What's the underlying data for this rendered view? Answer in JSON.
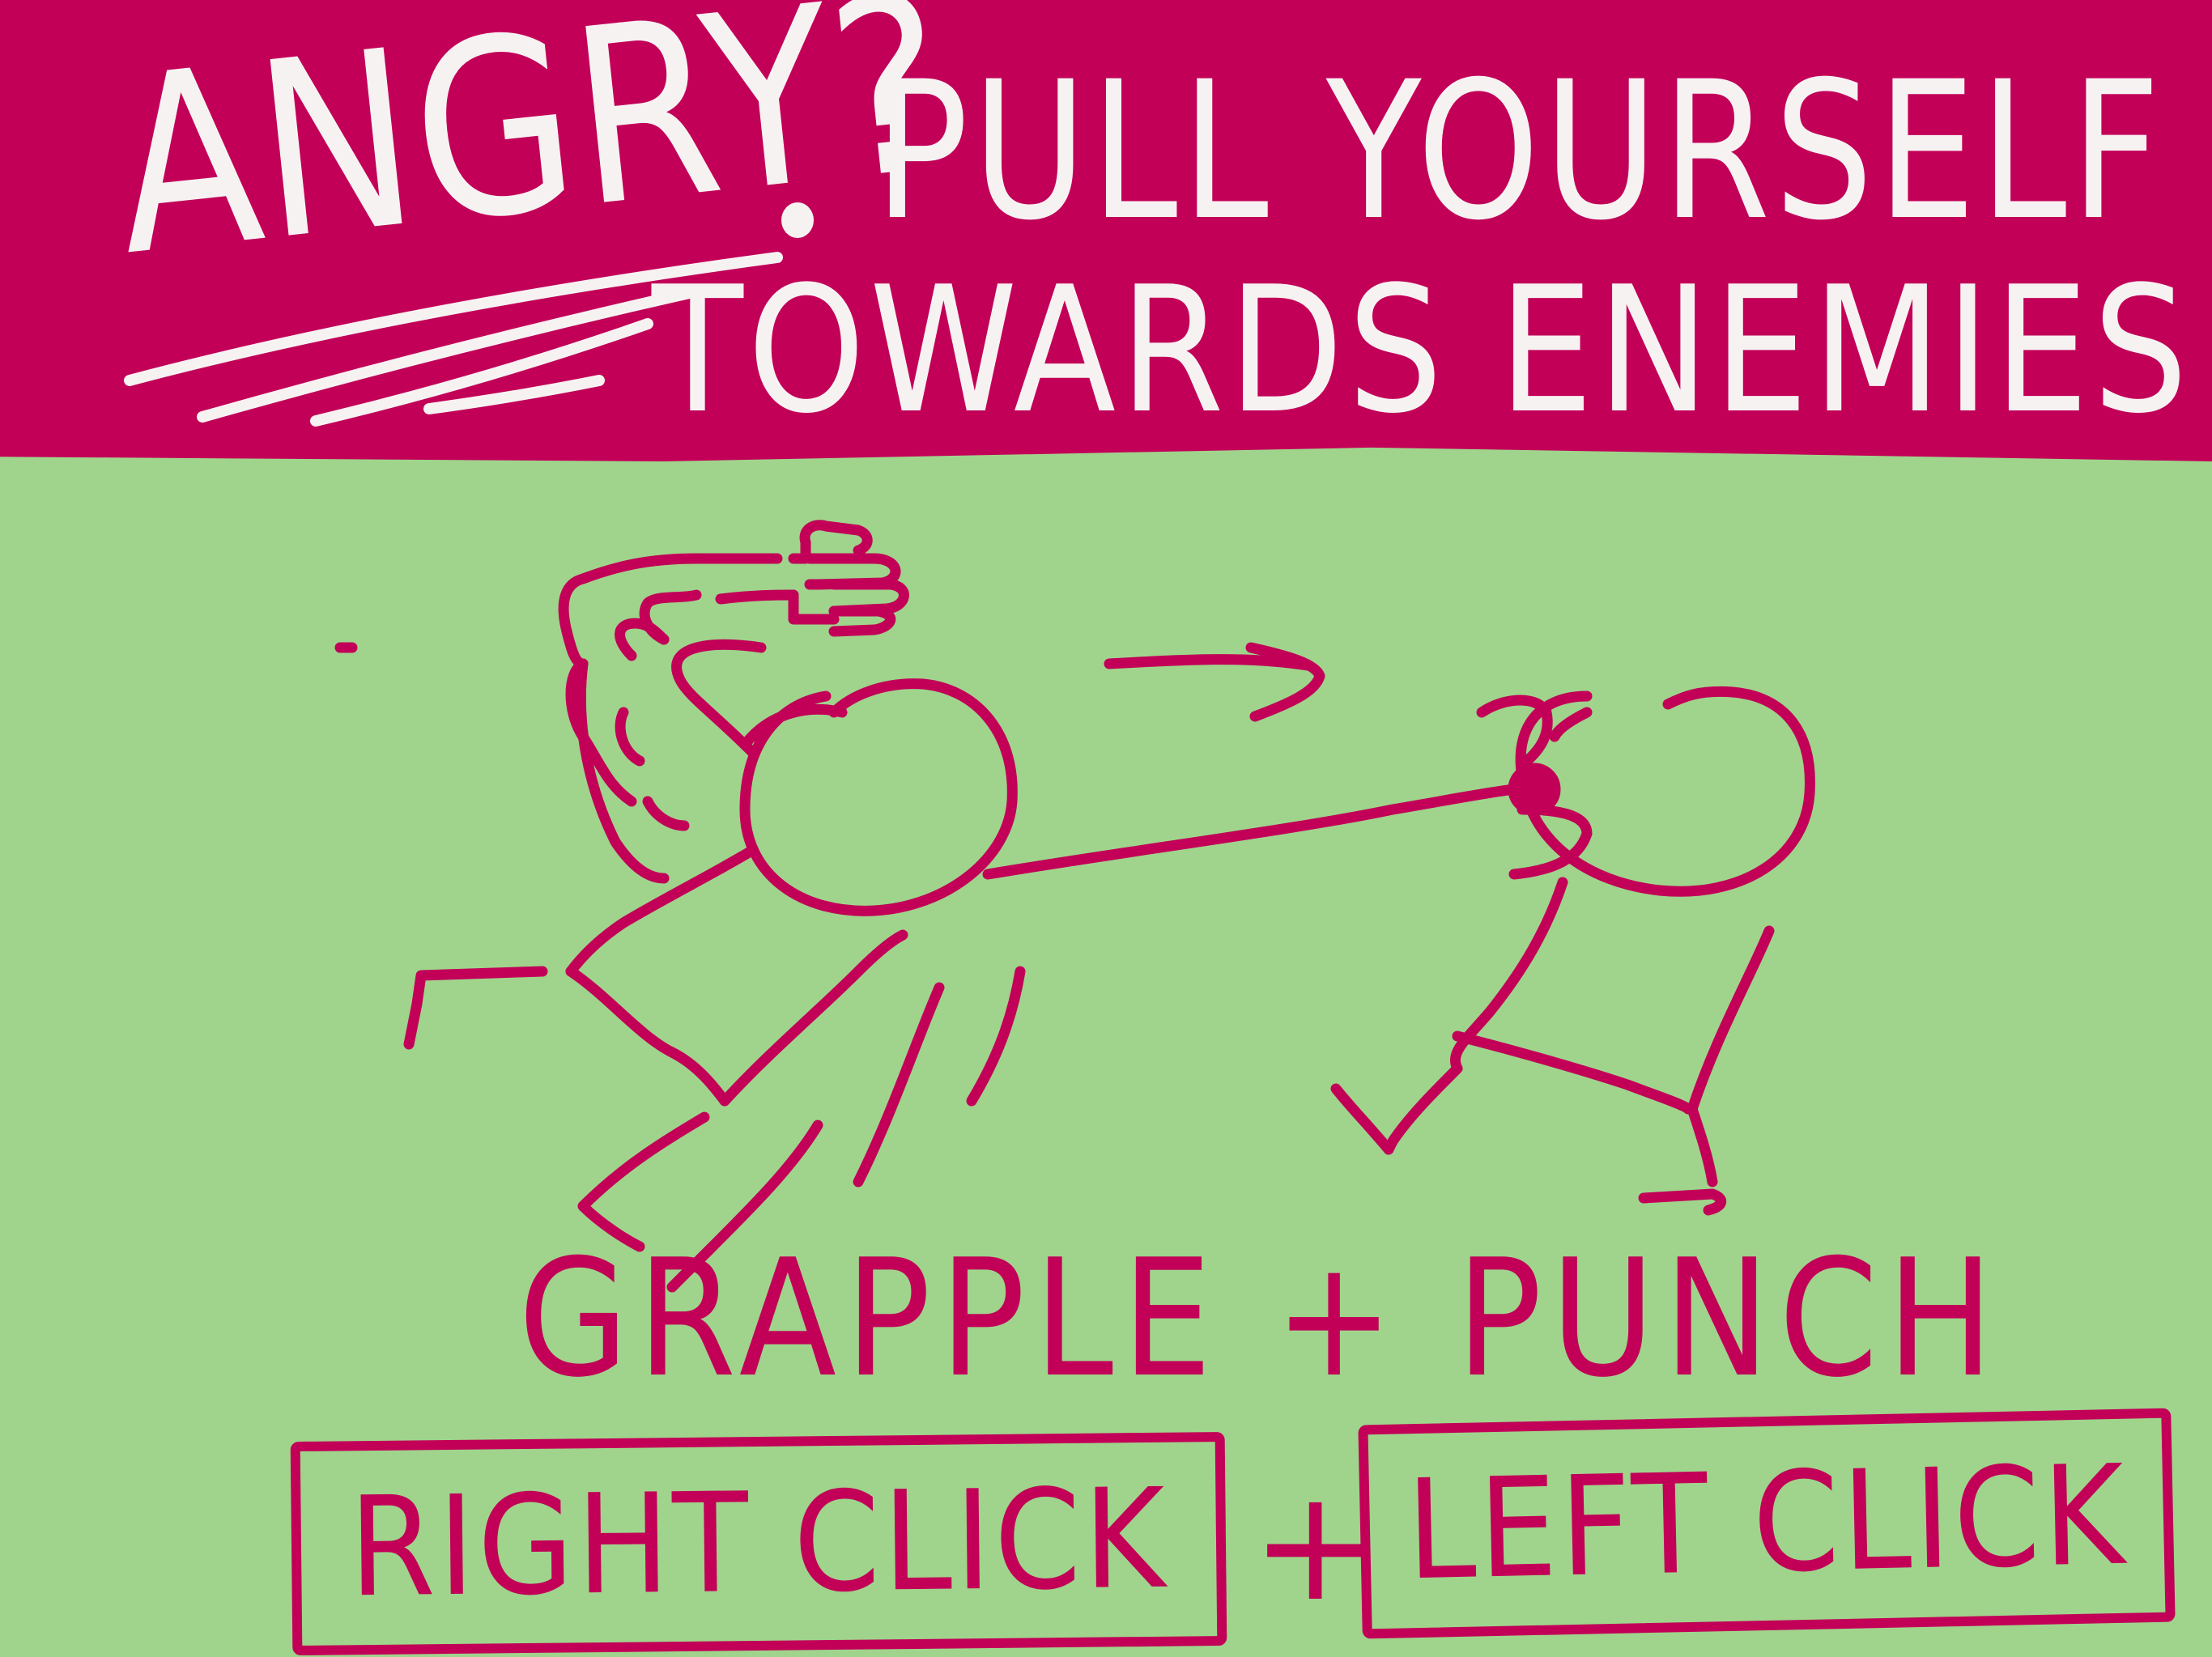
{
  "banner": {
    "line1_word": "ANGRY?",
    "line1_rest": "PULL YOURSELF",
    "line2": "TOWARDS ENEMIES"
  },
  "instructions": {
    "action_text": "GRAPPLE + PUNCH",
    "right_key": "RIGHT CLICK",
    "plus": "+",
    "left_key": "LEFT CLICK"
  },
  "colors": {
    "banner": "#c20058",
    "background": "#a0d48c",
    "banner_text": "#f7f2f2",
    "ink": "#c20058"
  },
  "icons": {
    "player": "stick-figure-icon",
    "enemy": "stick-figure-icon",
    "fist": "fist-icon",
    "direction": "arrow-right-icon"
  }
}
